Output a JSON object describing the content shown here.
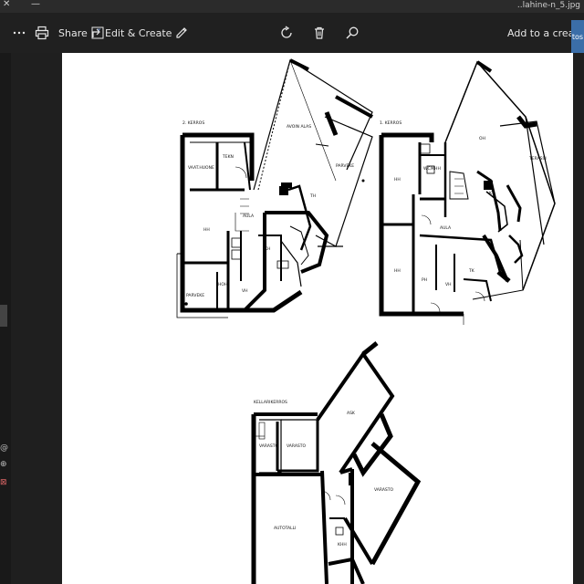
{
  "titlebar": {
    "filename": "..lahine-n_5.jpg",
    "minimize_glyph": "—",
    "close_glyph": "✕"
  },
  "toolbar": {
    "more_icon": "more-icon",
    "print_icon": "print-icon",
    "share_label": "Share",
    "edit_create_label": "Edit & Create",
    "edit_chevron": "˅",
    "rotate_icon": "rotate-icon",
    "delete_icon": "delete-icon",
    "zoom_icon": "zoom-icon",
    "add_to_creation_label": "Add to a creation",
    "photos_tab_label": "tos"
  },
  "left_rail": {
    "glyphs": [
      "@",
      "⊕",
      "⊠"
    ]
  },
  "floorplan": {
    "labels": {
      "upper_floor_caption": "2. KERROS",
      "main_floor_caption": "1. KERROS",
      "basement_caption": "KELLARIKERROS",
      "avoin_alas": "AVOIN ALAS",
      "parveke_upper": "PARVEKE",
      "tekn": "TEKN",
      "vaatehuone": "VAAT.HUONE",
      "th_upper": "TH",
      "hh_upper": "HH",
      "aula": "AULA",
      "kh": "KH",
      "parveke_lower": "PARVEKE",
      "hoh": "HOH",
      "vh_upper": "VH",
      "oh": "OH",
      "terassi": "TERASSI",
      "wc_khh": "WC/KHH",
      "hh_main_1": "HH",
      "hh_main_2": "HH",
      "k": "K",
      "aula_main": "AULA",
      "tk": "TK",
      "vh_main": "VH",
      "ph": "PH",
      "ask": "ASK",
      "varasto_1": "VARASTO",
      "varasto_2": "VARASTO",
      "varasto_3": "VARASTO",
      "autotalli": "AUTOTALLI",
      "khh": "KHH"
    }
  }
}
